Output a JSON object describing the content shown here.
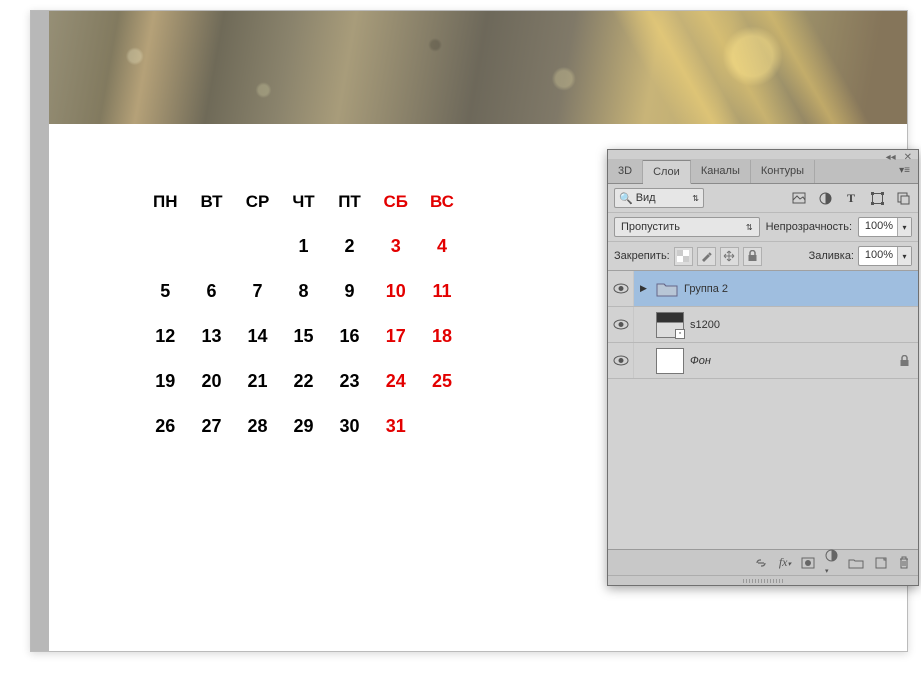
{
  "canvas": {
    "calendar": {
      "headers": [
        "ПН",
        "ВТ",
        "СР",
        "ЧТ",
        "ПТ",
        "СБ",
        "ВС"
      ],
      "weeks": [
        [
          "",
          "",
          "",
          "1",
          "2",
          "3",
          "4"
        ],
        [
          "5",
          "6",
          "7",
          "8",
          "9",
          "10",
          "11"
        ],
        [
          "12",
          "13",
          "14",
          "15",
          "16",
          "17",
          "18"
        ],
        [
          "19",
          "20",
          "21",
          "22",
          "23",
          "24",
          "25"
        ],
        [
          "26",
          "27",
          "28",
          "29",
          "30",
          "31",
          ""
        ]
      ]
    }
  },
  "panel": {
    "tabs": {
      "t3d": "3D",
      "layers": "Слои",
      "channels": "Каналы",
      "paths": "Контуры"
    },
    "filter": {
      "label": "Вид"
    },
    "blend": {
      "mode": "Пропустить"
    },
    "opacity": {
      "label": "Непрозрачность:",
      "value": "100%"
    },
    "lock": {
      "label": "Закрепить:"
    },
    "fill": {
      "label": "Заливка:",
      "value": "100%"
    },
    "layers": [
      {
        "name": "Группа 2",
        "type": "group",
        "selected": true
      },
      {
        "name": "s1200",
        "type": "image"
      },
      {
        "name": "Фон",
        "type": "bg",
        "locked": true
      }
    ]
  }
}
